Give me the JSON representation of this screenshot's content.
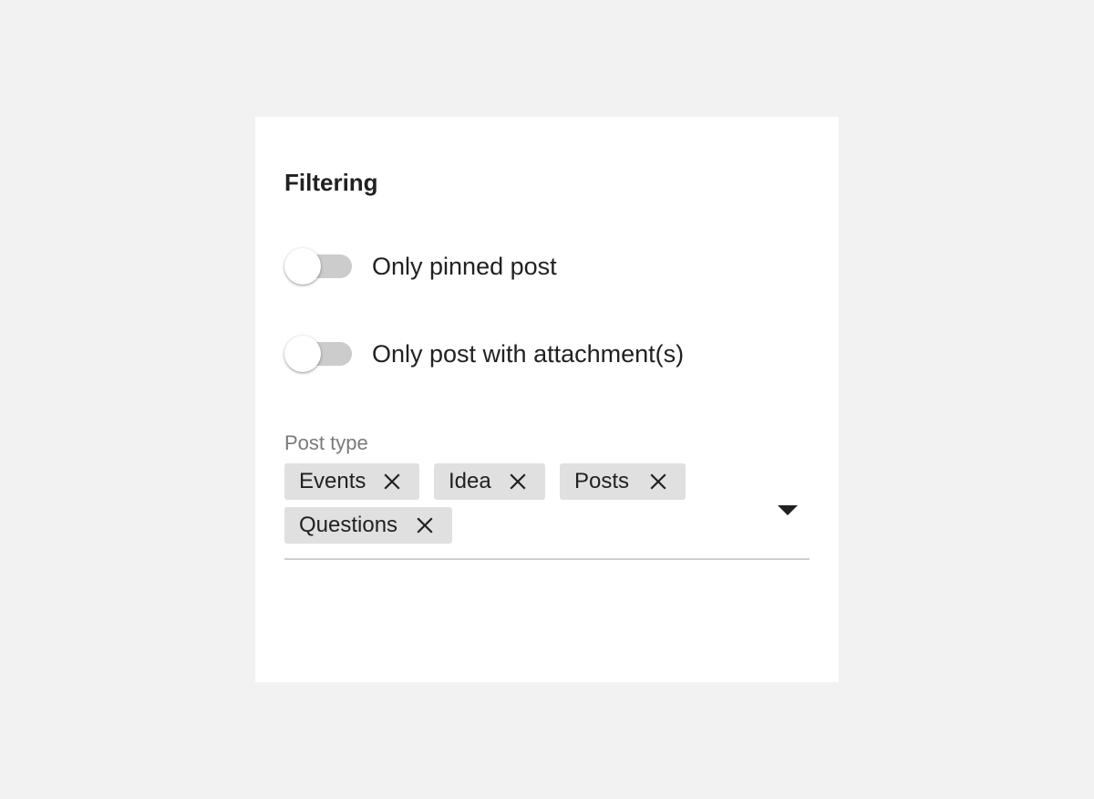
{
  "panel": {
    "title": "Filtering"
  },
  "toggles": [
    {
      "label": "Only pinned post",
      "checked": false
    },
    {
      "label": "Only post with attachment(s)",
      "checked": false
    }
  ],
  "post_type": {
    "label": "Post type",
    "chips": [
      {
        "label": "Events"
      },
      {
        "label": "Idea"
      },
      {
        "label": "Posts"
      },
      {
        "label": "Questions"
      }
    ]
  },
  "icons": {
    "chip_remove": "close-icon",
    "dropdown": "caret-down-icon"
  },
  "colors": {
    "page_background": "#f2f2f2",
    "card_background": "#ffffff",
    "switch_track": "#cccccc",
    "chip_background": "#e0e0e0",
    "text_primary": "#212121",
    "text_secondary": "#7a7a7a"
  }
}
